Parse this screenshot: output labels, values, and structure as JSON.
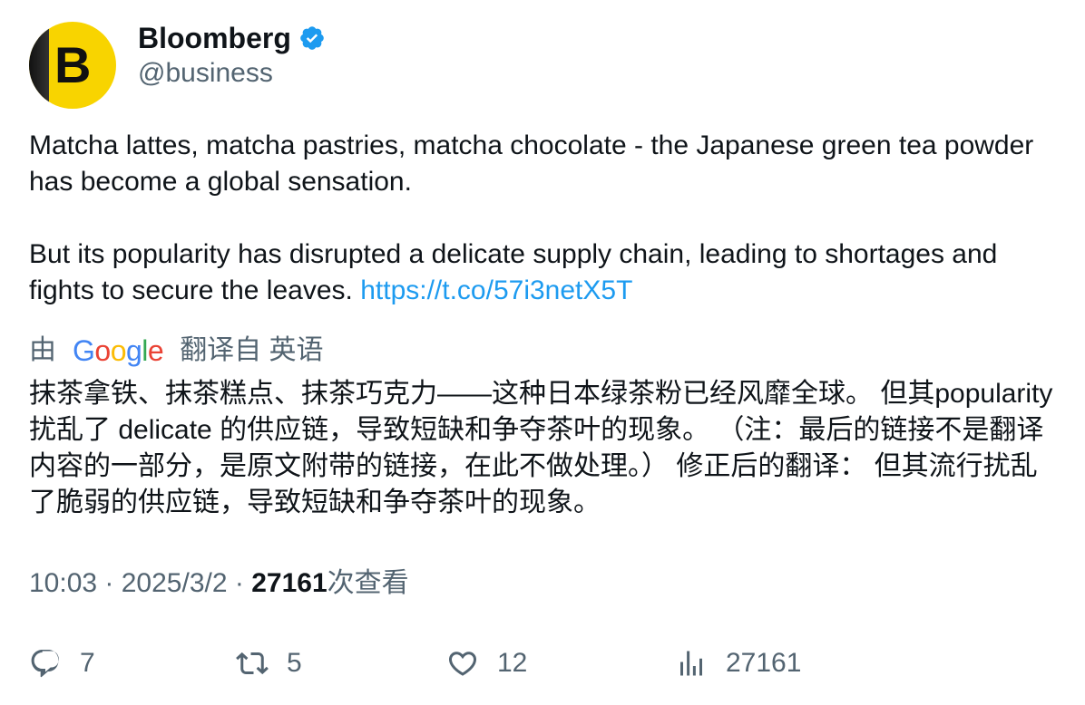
{
  "account": {
    "name": "Bloomberg",
    "handle": "@business",
    "avatar_letter": "B"
  },
  "tweet": {
    "paragraph1": "Matcha lattes, matcha pastries, matcha chocolate - the Japanese green tea powder has become a global sensation.",
    "paragraph2": "But its popularity has disrupted a delicate supply chain, leading to shortages and fights to secure the leaves.",
    "link": "https://t.co/57i3netX5T"
  },
  "translation": {
    "by_label": "由",
    "google_letters": [
      "G",
      "o",
      "o",
      "g",
      "l",
      "e"
    ],
    "from_label": "翻译自 英语",
    "text": "抹茶拿铁、抹茶糕点、抹茶巧克力——这种日本绿茶粉已经风靡全球。 但其popularity 扰乱了 delicate 的供应链，导致短缺和争夺茶叶的现象。 （注：最后的链接不是翻译内容的一部分，是原文附带的链接，在此不做处理。） 修正后的翻译： 但其流行扰乱了脆弱的供应链，导致短缺和争夺茶叶的现象。"
  },
  "meta": {
    "time": "10:03",
    "sep1": " · ",
    "date": "2025/3/2",
    "sep2": " · ",
    "views": "27161",
    "views_label": "次查看"
  },
  "actions": {
    "reply_count": "7",
    "retweet_count": "5",
    "like_count": "12",
    "views_count": "27161"
  },
  "colors": {
    "text": "#0f1419",
    "secondary": "#536471",
    "link": "#1d9bf0",
    "verified": "#1d9bf0",
    "avatar_bg": "#f8d400"
  },
  "icons": [
    "verified-badge-icon",
    "reply-icon",
    "retweet-icon",
    "like-icon",
    "views-icon"
  ]
}
